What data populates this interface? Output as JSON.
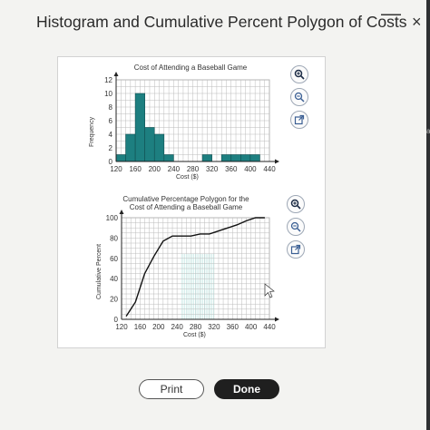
{
  "window": {
    "title": "Histogram and Cumulative Percent Polygon of Costs",
    "minimize_label": "—",
    "close_label": "×"
  },
  "buttons": {
    "print": "Print",
    "done": "Done"
  },
  "edge_char": "a",
  "chart_data": [
    {
      "type": "bar",
      "title": "Cost of Attending a Baseball Game",
      "xlabel": "Cost ($)",
      "ylabel": "Frequency",
      "xlim": [
        120,
        440
      ],
      "ylim": [
        0,
        12
      ],
      "xticks": [
        120,
        160,
        200,
        240,
        280,
        320,
        360,
        400,
        440
      ],
      "yticks": [
        0,
        2,
        4,
        6,
        8,
        10,
        12
      ],
      "bin_edges": [
        120,
        140,
        160,
        180,
        200,
        220,
        240,
        260,
        280,
        300,
        320,
        340,
        360,
        380,
        400,
        420,
        440
      ],
      "values": [
        1,
        4,
        10,
        5,
        4,
        1,
        0,
        0,
        0,
        1,
        0,
        1,
        1,
        1,
        1,
        0
      ],
      "grid": true
    },
    {
      "type": "line",
      "title": "Cumulative Percentage Polygon for the Cost of Attending a Baseball Game",
      "xlabel": "Cost ($)",
      "ylabel": "Cumulative Percent",
      "xlim": [
        120,
        440
      ],
      "ylim": [
        0,
        100
      ],
      "xticks": [
        120,
        160,
        200,
        240,
        280,
        320,
        360,
        400,
        440
      ],
      "yticks": [
        0,
        20,
        40,
        60,
        80,
        100
      ],
      "x": [
        130,
        150,
        170,
        190,
        210,
        230,
        250,
        270,
        290,
        310,
        330,
        350,
        370,
        390,
        410,
        430
      ],
      "y": [
        3,
        17,
        45,
        62,
        77,
        82,
        82,
        82,
        84,
        84,
        87,
        90,
        93,
        97,
        100,
        100
      ],
      "grid": true
    }
  ]
}
